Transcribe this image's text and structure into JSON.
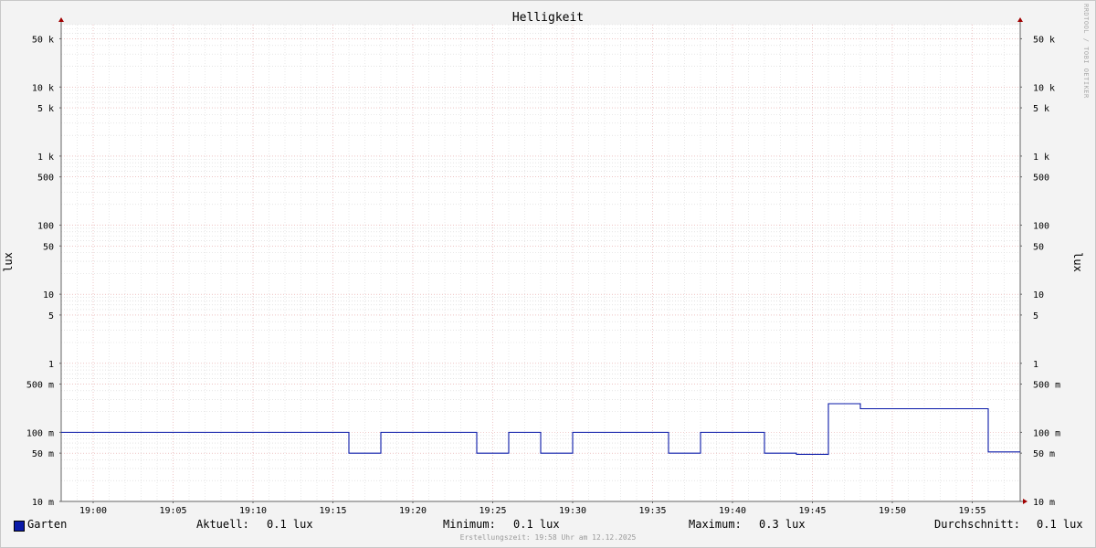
{
  "chart_data": {
    "type": "line",
    "title": "Helligkeit",
    "ylabel": "lux",
    "y_scale": "log",
    "ylim": [
      0.01,
      80000
    ],
    "y_ticks": [
      {
        "v": 0.01,
        "label": "10 m"
      },
      {
        "v": 0.05,
        "label": "50 m"
      },
      {
        "v": 0.1,
        "label": "100 m"
      },
      {
        "v": 0.5,
        "label": "500 m"
      },
      {
        "v": 1,
        "label": "1"
      },
      {
        "v": 5,
        "label": "5"
      },
      {
        "v": 10,
        "label": "10"
      },
      {
        "v": 50,
        "label": "50"
      },
      {
        "v": 100,
        "label": "100"
      },
      {
        "v": 500,
        "label": "500"
      },
      {
        "v": 1000,
        "label": "1 k"
      },
      {
        "v": 5000,
        "label": "5 k"
      },
      {
        "v": 10000,
        "label": "10 k"
      },
      {
        "v": 50000,
        "label": "50 k"
      }
    ],
    "x_unit": "minutes",
    "xlim": [
      "18:58",
      "19:58"
    ],
    "x_ticks": [
      "19:00",
      "19:05",
      "19:10",
      "19:15",
      "19:20",
      "19:25",
      "19:30",
      "19:35",
      "19:40",
      "19:45",
      "19:50",
      "19:55"
    ],
    "series": [
      {
        "name": "Garten",
        "color": "#0a1aa8",
        "step": true,
        "x": [
          "18:58",
          "19:16",
          "19:18",
          "19:24",
          "19:26",
          "19:28",
          "19:30",
          "19:36",
          "19:38",
          "19:42",
          "19:44",
          "19:46",
          "19:48",
          "19:56",
          "19:58"
        ],
        "y": [
          0.1,
          0.05,
          0.1,
          0.05,
          0.1,
          0.05,
          0.1,
          0.05,
          0.1,
          0.05,
          0.048,
          0.26,
          0.22,
          0.052,
          0.052
        ]
      }
    ],
    "grid": true,
    "legend": "bottom"
  },
  "legend": {
    "series_name": "Garten",
    "current_label": "Aktuell:",
    "current_value": "0.1 lux",
    "min_label": "Minimum:",
    "min_value": "0.1 lux",
    "max_label": "Maximum:",
    "max_value": "0.3 lux",
    "avg_label": "Durchschnitt:",
    "avg_value": "0.1 lux"
  },
  "footer": "Erstellungszeit: 19:58 Uhr am 12.12.2025",
  "watermark": "RRDTOOL / TOBI OETIKER"
}
